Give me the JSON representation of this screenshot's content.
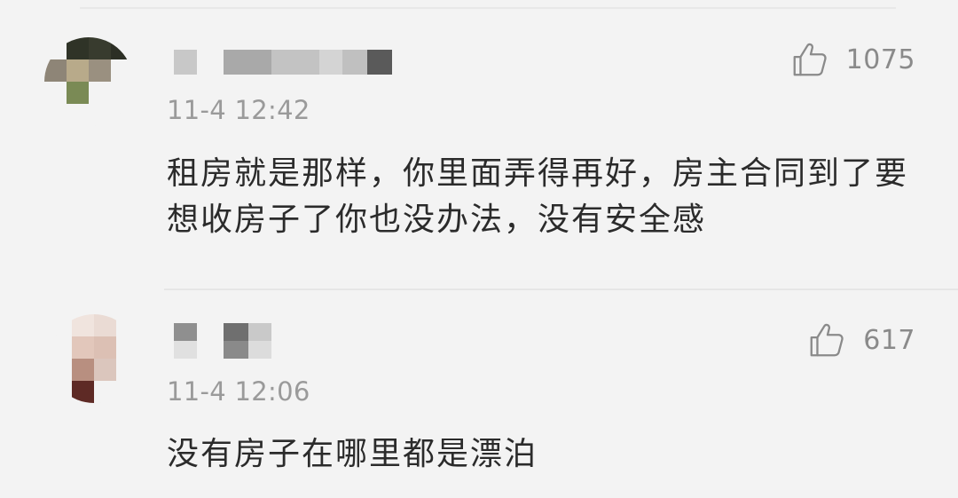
{
  "comments": [
    {
      "username_blurred": true,
      "like_count": "1075",
      "timestamp": "11-4 12:42",
      "text": "租房就是那样，你里面弄得再好，房主合同到了要想收房子了你也没办法，没有安全感"
    },
    {
      "username_blurred": true,
      "like_count": "617",
      "timestamp": "11-4 12:06",
      "text": "没有房子在哪里都是漂泊"
    }
  ],
  "icons": {
    "like": "thumbs-up-icon"
  },
  "colors": {
    "background": "#f3f3f3",
    "text": "#2b2b2b",
    "meta": "#9a9a9a",
    "like": "#8a8a8a"
  }
}
